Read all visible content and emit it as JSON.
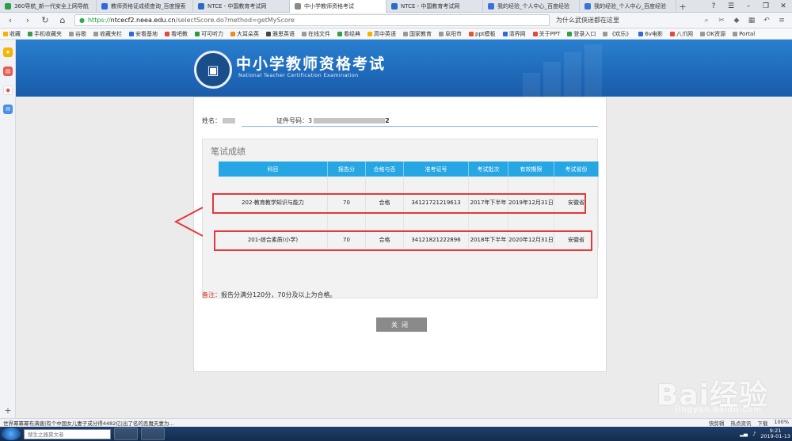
{
  "browser": {
    "tabs": [
      {
        "label": "360导航_新一代安全上网导航",
        "color": "#2b9c42",
        "active": false
      },
      {
        "label": "教师资格证成绩查询_百度搜索",
        "color": "#2f6ad8",
        "active": false
      },
      {
        "label": "NTCE - 中国教育考试网",
        "color": "#2a6bc4",
        "active": false
      },
      {
        "label": "中小学教师资格考试",
        "color": "#888888",
        "active": true
      },
      {
        "label": "NTCE - 中国教育考试网",
        "color": "#2a6bc4",
        "active": false
      },
      {
        "label": "我的经验_个人中心_百度经验",
        "color": "#3a72d8",
        "active": false
      },
      {
        "label": "我的经验_个人中心_百度经验",
        "color": "#3a72d8",
        "active": false
      }
    ],
    "new_tab": "+",
    "url_scheme": "https://",
    "url_host": "ntcecf2.neea.edu.cn",
    "url_path": "/selectScore.do?method=getMyScore",
    "search_hint": "为什么武侠迷都在这里",
    "bookmarks": [
      "收藏",
      "手机收藏夹",
      "谷歌",
      "收藏夹栏",
      "安看基地",
      "看吧教",
      "可可听力",
      "大耳朵英",
      "雅思英语",
      "在线文件",
      "看经典",
      "高中英语",
      "国家教育",
      "阜阳市",
      "ppt模板",
      "清界网",
      "关于PPT",
      "登录入口",
      "《欢乐》",
      "6v电影",
      "八爪网",
      "OK资源",
      "Portal"
    ]
  },
  "header": {
    "title": "中小学教师资格考试",
    "subtitle": "National Teacher Certification Examination"
  },
  "candidate": {
    "name_label": "姓名：",
    "id_label": "证件号码：",
    "id_prefix": "3",
    "id_suffix": "2"
  },
  "results": {
    "section_title": "笔试成绩",
    "columns": [
      "科目",
      "报告分",
      "合格与否",
      "准考证号",
      "考试批次",
      "有效期限",
      "考试省份"
    ],
    "rows": [
      {
        "subject": "202-教育教学知识与能力",
        "score": "70",
        "pass": "合格",
        "ticket": "34121721219613",
        "batch": "2017年下半年",
        "valid": "2019年12月31日",
        "province": "安徽省"
      },
      {
        "subject": "201-综合素质(小学)",
        "score": "70",
        "pass": "合格",
        "ticket": "34121821222896",
        "batch": "2018年下半年",
        "valid": "2020年12月31日",
        "province": "安徽省"
      }
    ],
    "note_label": "备注：",
    "note_text": "报告分满分120分，70分及以上为合格。",
    "close_label": "关闭"
  },
  "watermark": {
    "brand": "Bai经验",
    "site": "jingyan.baidu.com"
  },
  "statusbar": {
    "news": "世界冪冪冪布满唐|有个中国女儿妻子或分得4482亿|出了名的恶魔夫妻为...",
    "right": [
      "快剪辑",
      "热点资讯",
      "下载",
      "100%"
    ]
  },
  "taskbar": {
    "search_placeholder": "搜生之器莫文者",
    "time": "9:21",
    "date": "2019-01-13"
  }
}
